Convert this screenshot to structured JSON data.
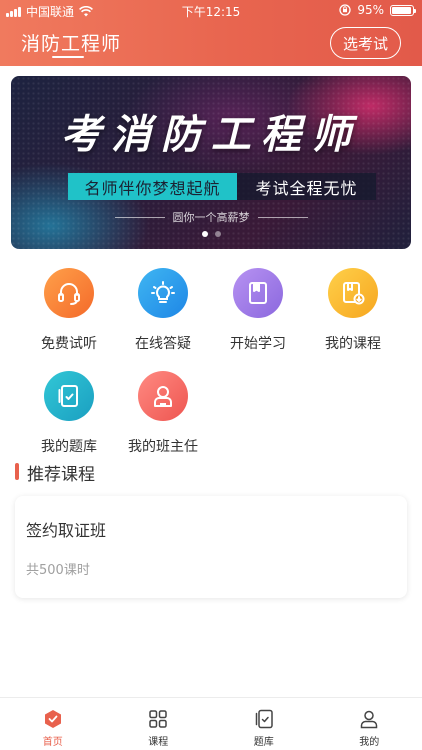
{
  "status_bar": {
    "carrier": "中国联通",
    "time": "下午12:15",
    "battery": "95%",
    "battery_level": 0.95
  },
  "header": {
    "title": "消防工程师",
    "select_exam_label": "选考试"
  },
  "banner": {
    "headline": "考消防工程师",
    "slogan_left": "名师伴你梦想起航",
    "slogan_right": "考试全程无忧",
    "subline": "圆你一个高薪梦",
    "slide_count": 2,
    "active_slide": 1
  },
  "features": [
    {
      "label": "免费试听",
      "icon": "headset-icon",
      "color": "#f6772f"
    },
    {
      "label": "在线答疑",
      "icon": "lightbulb-icon",
      "color": "#2596ea"
    },
    {
      "label": "开始学习",
      "icon": "book-icon",
      "color": "#9573e3"
    },
    {
      "label": "我的课程",
      "icon": "course-download-icon",
      "color": "#f7ad24"
    },
    {
      "label": "我的题库",
      "icon": "question-bank-icon",
      "color": "#20a8c8"
    },
    {
      "label": "我的班主任",
      "icon": "teacher-icon",
      "color": "#f06059"
    }
  ],
  "recommended": {
    "section_title": "推荐课程",
    "courses": [
      {
        "name": "签约取证班",
        "hours": "共500课时"
      }
    ]
  },
  "tabbar": {
    "active": "home",
    "tabs": [
      {
        "id": "home",
        "label": "首页",
        "icon": "home-icon"
      },
      {
        "id": "courses",
        "label": "课程",
        "icon": "grid-icon"
      },
      {
        "id": "bank",
        "label": "题库",
        "icon": "question-bank-icon"
      },
      {
        "id": "mine",
        "label": "我的",
        "icon": "user-icon"
      }
    ]
  },
  "colors": {
    "brand": "#e8654f",
    "accent_teal": "#20c2c8",
    "text_primary": "#333333",
    "text_muted": "#a0a0a0"
  }
}
